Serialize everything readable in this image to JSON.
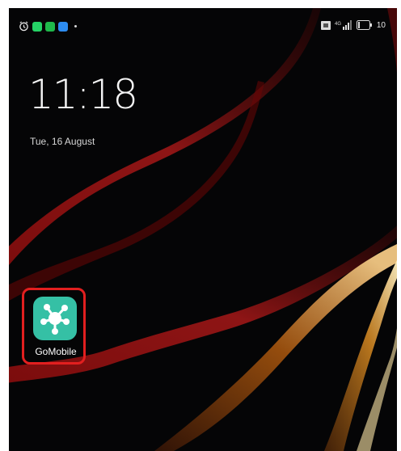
{
  "status_bar": {
    "left_icons": [
      "alarm-icon",
      "whatsapp-notification-icon",
      "green-app-notification-icon",
      "message-notification-icon",
      "more-notifications-dot"
    ],
    "right_icons": [
      "sim-icon",
      "signal-icon",
      "battery-icon"
    ],
    "battery_text": "10"
  },
  "lock_screen": {
    "time": "11:18",
    "date": "Tue, 16 August"
  },
  "home_apps": [
    {
      "label": "GoMobile",
      "icon": "gomobile-network-icon",
      "highlighted": true,
      "icon_color": "#35c0a5"
    }
  ],
  "colors": {
    "highlight": "#e21f1f",
    "background": "#050506",
    "text": "#f4f4f4"
  }
}
